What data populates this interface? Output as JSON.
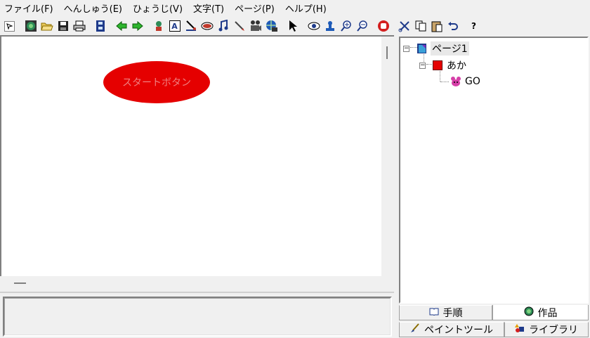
{
  "menu": [
    {
      "label": "ファイル(F)"
    },
    {
      "label": "へんしゅう(E)"
    },
    {
      "label": "ひょうじ(V)"
    },
    {
      "label": "文字(T)"
    },
    {
      "label": "ページ(P)"
    },
    {
      "label": "ヘルプ(H)"
    }
  ],
  "toolbar": {
    "icons": [
      "pointer-small-icon",
      "world-icon",
      "open-folder-icon",
      "save-disk-icon",
      "print-icon",
      "film-strip-icon",
      "arrow-left-icon",
      "arrow-right-icon",
      "character-icon",
      "text-A-icon",
      "brush-icon",
      "eye-shape-icon",
      "music-note-icon",
      "pen-icon",
      "camera-icon",
      "globe-link-icon",
      "arrow-cursor-icon",
      "eye-icon",
      "stamp-icon",
      "zoom-in-icon",
      "zoom-out-icon",
      "stop-hand-icon",
      "cut-icon",
      "copy-icon",
      "paste-icon",
      "undo-icon",
      "help-icon"
    ],
    "help_label": "?"
  },
  "canvas": {
    "start_button_text": "スタートボタン",
    "start_button_color": "#e50000"
  },
  "tree": {
    "page": {
      "label": "ページ1",
      "expander": "−"
    },
    "object": {
      "label": "あか",
      "expander": "−"
    },
    "script": {
      "label": "GO"
    }
  },
  "tabs": {
    "steps": "手順",
    "works": "作品",
    "paint": "ペイントツール",
    "library": "ライブラリ"
  }
}
